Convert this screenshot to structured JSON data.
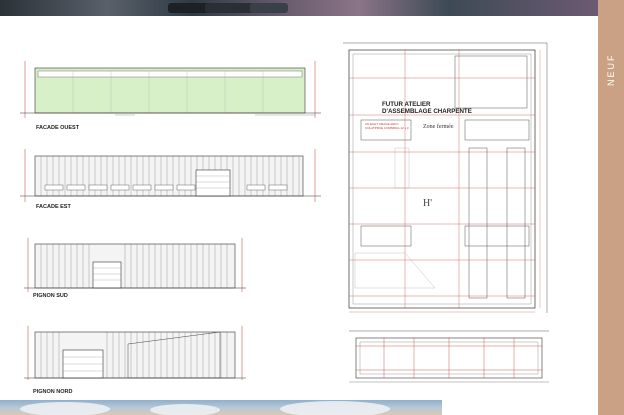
{
  "side_band": {
    "label": "NEUF"
  },
  "facades": [
    {
      "caption": "FACADE OUEST"
    },
    {
      "caption": "FACADE EST"
    },
    {
      "caption": "PIGNON SUD"
    },
    {
      "caption": "PIGNON NORD"
    }
  ],
  "plan": {
    "title_line1": "FUTUR ATELIER",
    "title_line2": "D'ASSEMBLAGE CHARPENTE",
    "zone_label": "Zone fermée",
    "room_label_line1": "ZO ECHT URAGE  ARKC",
    "room_label_line2": "COLATPRCE  COMMPAG  12 x 3",
    "h_tag": "H'"
  },
  "colors": {
    "side_band": "#caa184",
    "accent_red": "#c0392b",
    "facade_green": "#d8f0c8"
  }
}
